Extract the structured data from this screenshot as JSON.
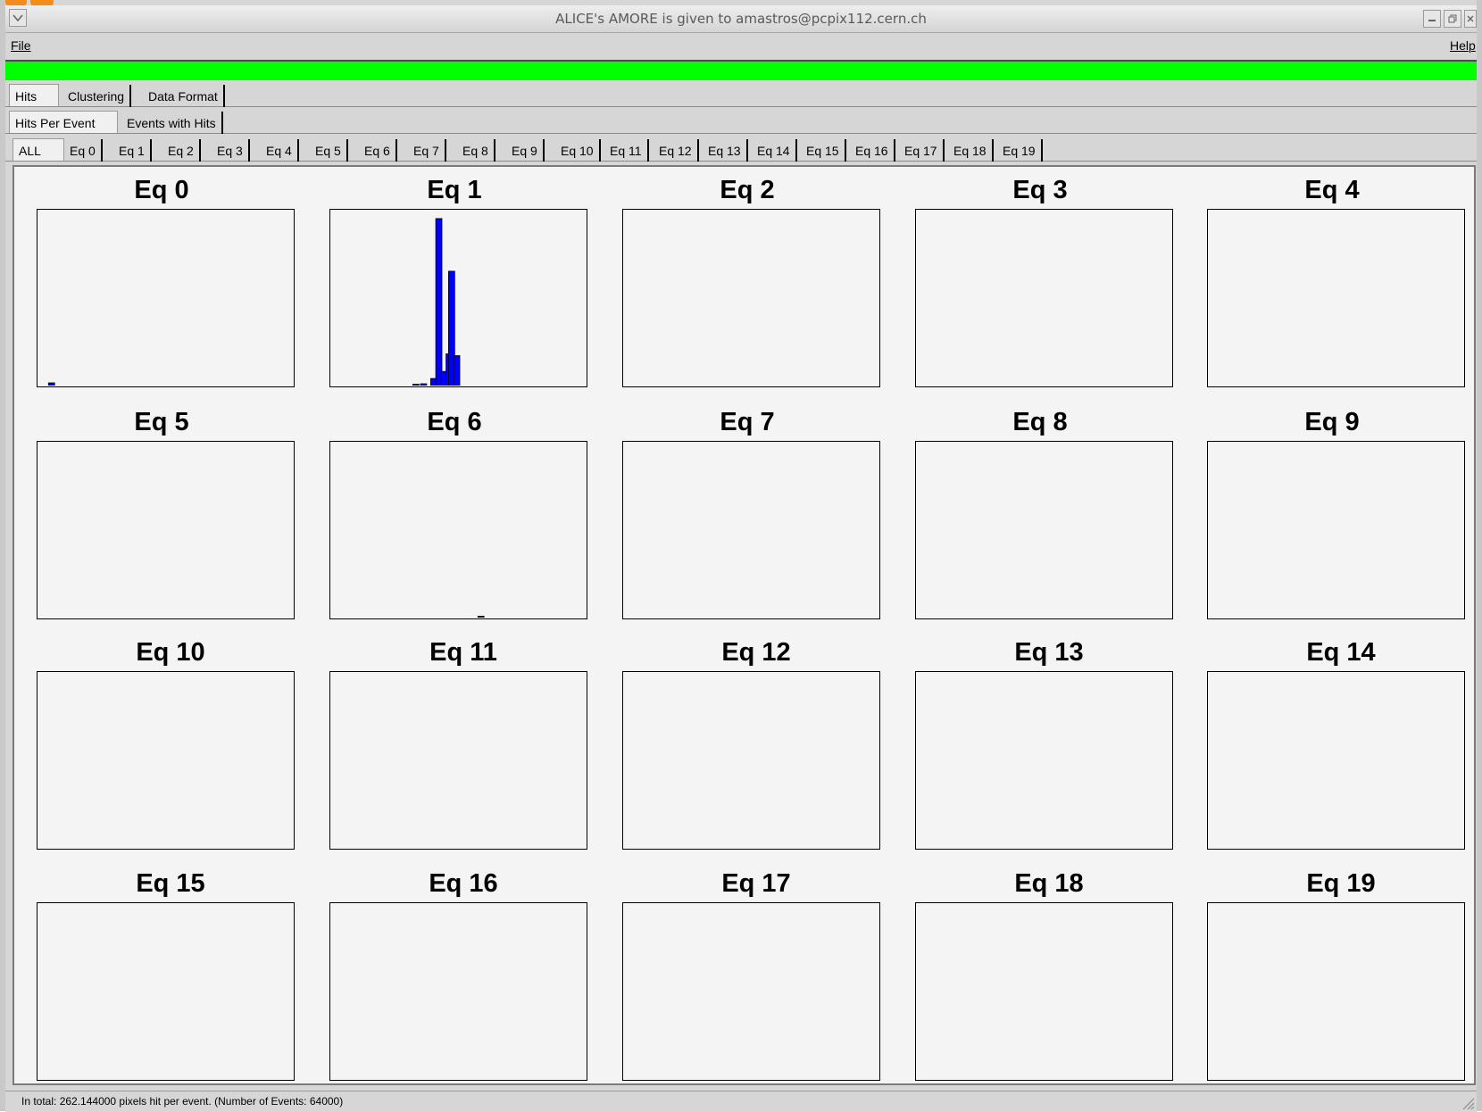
{
  "window": {
    "title": "ALICE's AMORE is given to amastros@pcpix112.cern.ch",
    "menu_icon": "chevron-down-icon",
    "controls": [
      "minimize-icon",
      "restore-icon",
      "close-icon"
    ]
  },
  "menubar": {
    "file": "File",
    "help": "Help"
  },
  "status_color": "#00ff00",
  "main_tabs": [
    {
      "label": "Hits",
      "active": true
    },
    {
      "label": "Clustering",
      "active": false
    },
    {
      "label": "Data Format",
      "active": false
    }
  ],
  "sub_tabs": [
    {
      "label": "Hits Per Event",
      "active": true
    },
    {
      "label": "Events with Hits",
      "active": false
    }
  ],
  "eq_tabs": [
    "ALL",
    "Eq 0",
    "Eq 1",
    "Eq 2",
    "Eq 3",
    "Eq 4",
    "Eq 5",
    "Eq 6",
    "Eq 7",
    "Eq 8",
    "Eq 9",
    "Eq 10",
    "Eq 11",
    "Eq 12",
    "Eq 13",
    "Eq 14",
    "Eq 15",
    "Eq 16",
    "Eq 17",
    "Eq 18",
    "Eq 19"
  ],
  "plots": [
    {
      "title": "Eq 0"
    },
    {
      "title": "Eq 1"
    },
    {
      "title": "Eq 2"
    },
    {
      "title": "Eq 3"
    },
    {
      "title": "Eq 4"
    },
    {
      "title": "Eq 5"
    },
    {
      "title": "Eq 6"
    },
    {
      "title": "Eq 7"
    },
    {
      "title": "Eq 8"
    },
    {
      "title": "Eq 9"
    },
    {
      "title": "Eq 10"
    },
    {
      "title": "Eq 11"
    },
    {
      "title": "Eq 12"
    },
    {
      "title": "Eq 13"
    },
    {
      "title": "Eq 14"
    },
    {
      "title": "Eq 15"
    },
    {
      "title": "Eq 16"
    },
    {
      "title": "Eq 17"
    },
    {
      "title": "Eq 18"
    },
    {
      "title": "Eq 19"
    }
  ],
  "chart_data": [
    {
      "type": "bar",
      "title": "Eq 0",
      "bar_color": "#0000ff",
      "xlim": [
        0,
        100
      ],
      "ylim": [
        0,
        100
      ],
      "x": [
        5.5
      ],
      "values": [
        1.5
      ]
    },
    {
      "type": "bar",
      "title": "Eq 1",
      "bar_color": "#0000ff",
      "xlim": [
        0,
        100
      ],
      "ylim": [
        0,
        100
      ],
      "x": [
        33.5,
        36.5,
        40.5,
        42.5,
        44.5,
        46.5,
        47.5,
        49.5
      ],
      "values": [
        0.5,
        1.0,
        4.0,
        95.0,
        8.0,
        18.0,
        65.0,
        17.0
      ]
    },
    {
      "type": "bar",
      "title": "Eq 6",
      "bar_color": "#000000",
      "xlim": [
        0,
        100
      ],
      "ylim": [
        0,
        100
      ],
      "x": [
        59.0
      ],
      "values": [
        0.6
      ]
    }
  ],
  "footer": {
    "summary": "In total: 262.144000 pixels hit per event.   (Number of Events: 64000)"
  }
}
